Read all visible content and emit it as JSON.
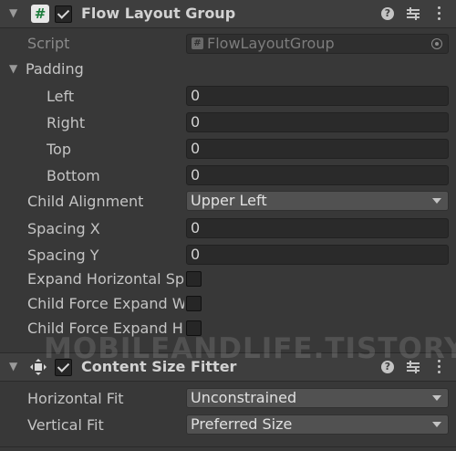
{
  "flow_layout_group": {
    "title": "Flow Layout Group",
    "enabled": true,
    "script_label": "Script",
    "script_value": "FlowLayoutGroup",
    "padding_label": "Padding",
    "left_label": "Left",
    "left_value": "0",
    "right_label": "Right",
    "right_value": "0",
    "top_label": "Top",
    "top_value": "0",
    "bottom_label": "Bottom",
    "bottom_value": "0",
    "child_alignment_label": "Child Alignment",
    "child_alignment_value": "Upper Left",
    "spacing_x_label": "Spacing X",
    "spacing_x_value": "0",
    "spacing_y_label": "Spacing Y",
    "spacing_y_value": "0",
    "expand_horizontal_label": "Expand Horizontal Sp",
    "child_force_expand_w_label": "Child Force Expand W",
    "child_force_expand_h_label": "Child Force Expand H"
  },
  "content_size_fitter": {
    "title": "Content Size Fitter",
    "enabled": true,
    "horizontal_fit_label": "Horizontal Fit",
    "horizontal_fit_value": "Unconstrained",
    "vertical_fit_label": "Vertical Fit",
    "vertical_fit_value": "Preferred Size"
  },
  "watermark": "MOBILEANDLIFE.TISTORY.COM",
  "icons": {
    "component_script": "hash-icon",
    "help": "help-icon",
    "presets": "preset-icon",
    "menu": "kebab-icon",
    "move": "move-icon"
  },
  "colors": {
    "background": "#383838",
    "header": "#3e3e3e",
    "field": "#2a2a2a",
    "dropdown": "#515151",
    "hash_green": "#1b7c3b"
  }
}
